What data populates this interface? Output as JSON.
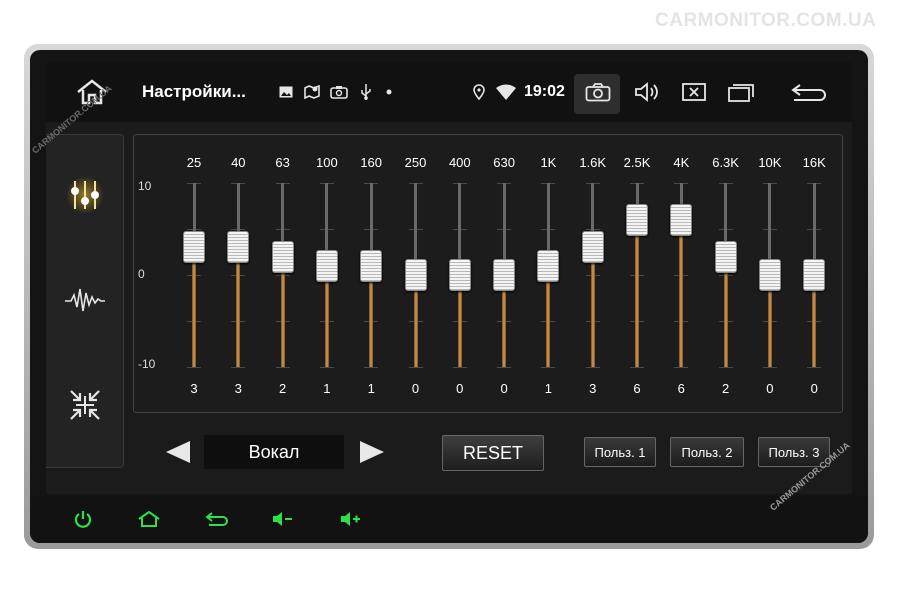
{
  "watermark": {
    "top": "CARMONITOR.COM.UA",
    "side": "CARMONITOR.COM.UA"
  },
  "statusbar": {
    "title": "Настройки...",
    "time": "19:02",
    "icons": [
      "home-icon",
      "image-icon",
      "map-icon",
      "screenshot-icon",
      "usb-icon",
      "dot-icon",
      "location-icon",
      "wifi-icon",
      "camera-icon",
      "volume-icon",
      "close-window-icon",
      "recent-apps-icon",
      "back-icon"
    ]
  },
  "sidebar": {
    "items": [
      "equalizer-icon",
      "waveform-icon",
      "balance-icon"
    ],
    "active": "equalizer-icon"
  },
  "equalizer": {
    "scale": {
      "max": "10",
      "mid": "0",
      "min": "-10"
    },
    "range": [
      -10,
      10
    ],
    "bands": [
      {
        "freq": "25",
        "value": 3
      },
      {
        "freq": "40",
        "value": 3
      },
      {
        "freq": "63",
        "value": 2
      },
      {
        "freq": "100",
        "value": 1
      },
      {
        "freq": "160",
        "value": 1
      },
      {
        "freq": "250",
        "value": 0
      },
      {
        "freq": "400",
        "value": 0
      },
      {
        "freq": "630",
        "value": 0
      },
      {
        "freq": "1K",
        "value": 1
      },
      {
        "freq": "1.6K",
        "value": 3
      },
      {
        "freq": "2.5K",
        "value": 6
      },
      {
        "freq": "4K",
        "value": 6
      },
      {
        "freq": "6.3K",
        "value": 2
      },
      {
        "freq": "10K",
        "value": 0
      },
      {
        "freq": "16K",
        "value": 0
      }
    ]
  },
  "preset": {
    "current": "Вокал",
    "prev_icon": "triangle-left-icon",
    "next_icon": "triangle-right-icon"
  },
  "buttons": {
    "reset": "RESET",
    "user1": "Польз. 1",
    "user2": "Польз. 2",
    "user3": "Польз. 3"
  },
  "bottombar": {
    "icons": [
      "power-icon",
      "home-icon",
      "back-icon",
      "volume-down-icon",
      "volume-up-icon"
    ],
    "color": "#2ee04a"
  },
  "colors": {
    "accent_active": "#f4c020",
    "slider_fill": "#c88a40"
  }
}
